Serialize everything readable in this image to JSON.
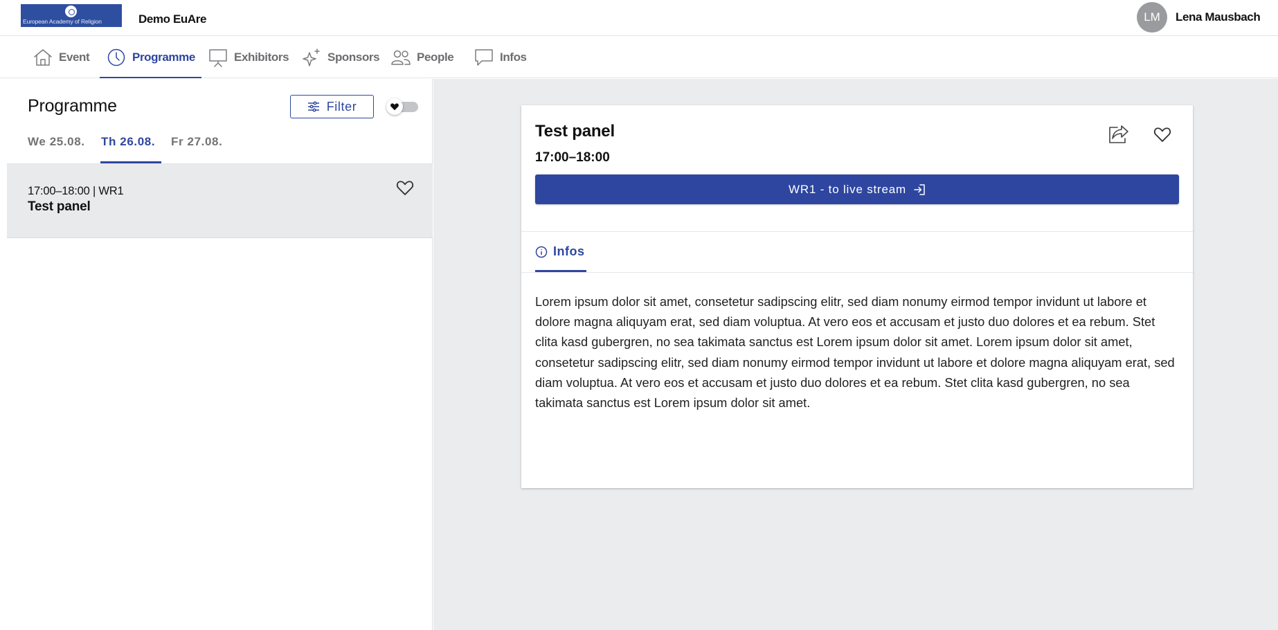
{
  "header": {
    "logo_text": "European Academy of Religion",
    "event_name": "Demo EuAre",
    "user": {
      "initials": "LM",
      "name": "Lena Mausbach"
    }
  },
  "nav": {
    "items": [
      {
        "label": "Event",
        "icon": "house-icon"
      },
      {
        "label": "Programme",
        "icon": "clock-icon",
        "active": true
      },
      {
        "label": "Exhibitors",
        "icon": "presentation-board-icon"
      },
      {
        "label": "Sponsors",
        "icon": "sparkle-star-icon"
      },
      {
        "label": "People",
        "icon": "people-icon"
      },
      {
        "label": "Infos",
        "icon": "chat-bubble-icon"
      }
    ]
  },
  "programme": {
    "title": "Programme",
    "filter_label": "Filter",
    "favorites_toggle_on": false,
    "days": [
      {
        "label": "We 25.08."
      },
      {
        "label": "Th 26.08.",
        "active": true
      },
      {
        "label": "Fr 27.08."
      }
    ],
    "sessions": [
      {
        "meta": "17:00–18:00 | WR1",
        "title": "Test panel",
        "favorite": false
      }
    ]
  },
  "detail": {
    "title": "Test panel",
    "time": "17:00–18:00",
    "stream_button_label": "WR1 - to live stream",
    "tab_label": "Infos",
    "description": "Lorem ipsum dolor sit amet, consetetur sadipscing elitr, sed diam nonumy eirmod tempor invidunt ut labore et dolore magna aliquyam erat, sed diam voluptua. At vero eos et accusam et justo duo dolores et ea rebum. Stet clita kasd gubergren, no sea takimata sanctus est Lorem ipsum dolor sit amet. Lorem ipsum dolor sit amet, consetetur sadipscing elitr, sed diam nonumy eirmod tempor invidunt ut labore et dolore magna aliquyam erat, sed diam voluptua. At vero eos et accusam et justo duo dolores et ea rebum. Stet clita kasd gubergren, no sea takimata sanctus est Lorem ipsum dolor sit amet."
  },
  "colors": {
    "accent": "#2e46a0",
    "logo_background": "#2e4ea0",
    "selected_row": "#e9eaec",
    "content_background": "#ebecee",
    "avatar": "#9a9b9e"
  }
}
